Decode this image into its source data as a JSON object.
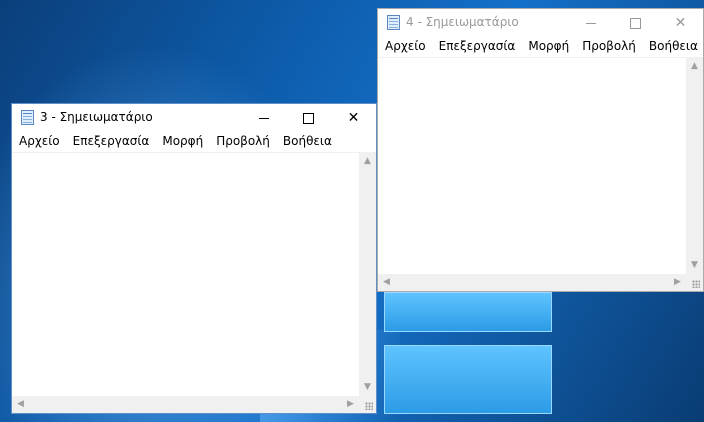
{
  "windows": [
    {
      "id": "notepad-4",
      "title": "4 - Σημειωματάριο",
      "active": false,
      "menu": [
        "Αρχείο",
        "Επεξεργασία",
        "Μορφή",
        "Προβολή",
        "Βοήθεια"
      ],
      "content": ""
    },
    {
      "id": "notepad-3",
      "title": "3 - Σημειωματάριο",
      "active": true,
      "menu": [
        "Αρχείο",
        "Επεξεργασία",
        "Μορφή",
        "Προβολή",
        "Βοήθεια"
      ],
      "content": ""
    }
  ],
  "icons": {
    "app": "notepad-icon",
    "minimize": "minimize-icon",
    "maximize": "maximize-icon",
    "close": "close-icon"
  },
  "glyphs": {
    "close": "✕",
    "up": "▲",
    "down": "▼",
    "left": "◀",
    "right": "▶"
  },
  "colors": {
    "desktop": "#0d5aa8",
    "active_border": "#5f8fc8",
    "inactive_text": "#999999"
  }
}
